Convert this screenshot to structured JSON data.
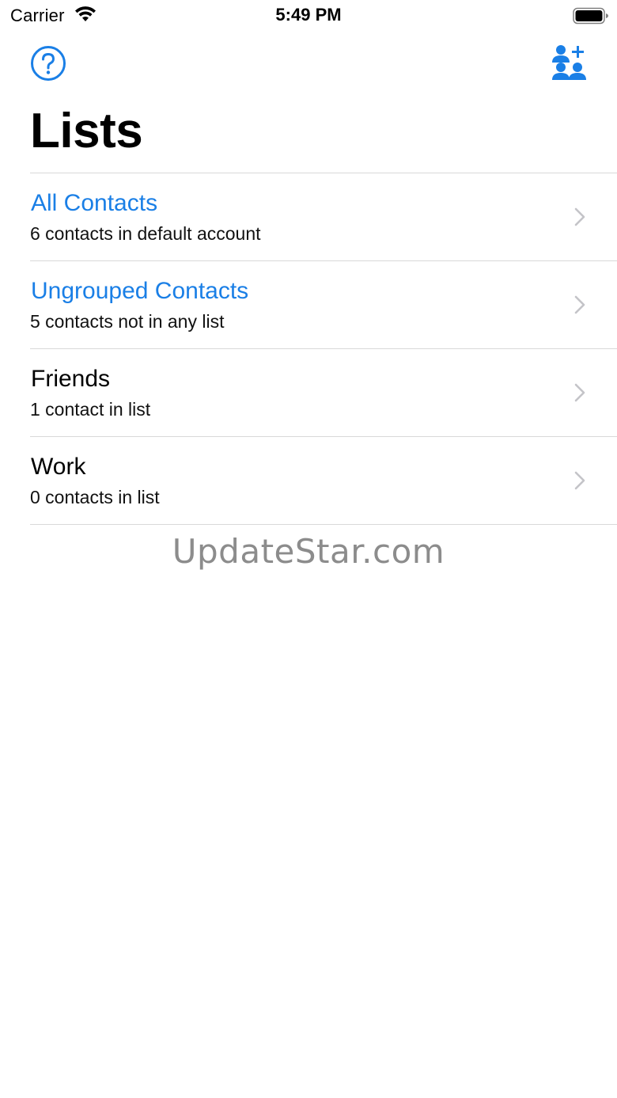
{
  "status_bar": {
    "carrier": "Carrier",
    "time": "5:49 PM",
    "wifi_icon": "wifi-icon",
    "battery_icon": "battery-full-icon"
  },
  "nav": {
    "help_icon": "question-circle-icon",
    "add_icon": "add-person-icon",
    "accent_color": "#1a7fe6"
  },
  "page": {
    "title": "Lists"
  },
  "lists": [
    {
      "title": "All Contacts",
      "subtitle": "6 contacts in default account",
      "accent": true
    },
    {
      "title": "Ungrouped Contacts",
      "subtitle": "5 contacts not in any list",
      "accent": true
    },
    {
      "title": "Friends",
      "subtitle": "1 contact in list",
      "accent": false
    },
    {
      "title": "Work",
      "subtitle": "0 contacts in list",
      "accent": false
    }
  ],
  "watermark": "UpdateStar.com"
}
